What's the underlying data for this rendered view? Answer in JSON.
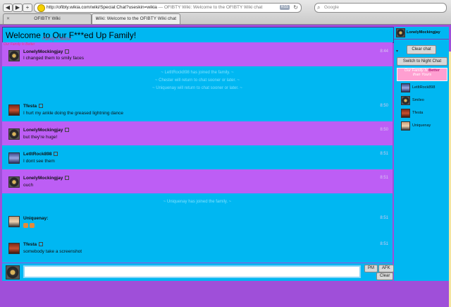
{
  "browser": {
    "url": "http://ofibty.wikia.com/wiki/Special:Chat?useskin=wikia",
    "window_title": "— OFIBTY Wiki: Welcome to the OFIBTY Wiki chat",
    "rss_label": "RSS",
    "search_placeholder": "Google",
    "tabs": [
      {
        "label": "OFIBTY Wiki"
      },
      {
        "label": "Wiki: Welcome to the OFIBTY Wiki chat"
      }
    ]
  },
  "chat": {
    "title": "Welcome to Our F***ed Up Family!",
    "watermark": "Family Is Better",
    "logo_text": "Our Family Is Better",
    "messages": [
      {
        "user": "LonelyMockingjay",
        "text": "I changed them to smily faces",
        "time": "8:44"
      },
      {
        "user": "Tfesta",
        "text": "I hurt my ankle doing the greased lightning dance",
        "time": "8:50"
      },
      {
        "user": "LonelyMockingjay",
        "text": "but they're huge!",
        "time": "8:50"
      },
      {
        "user": "LetItRock898",
        "text": "I dont see them",
        "time": "8:51"
      },
      {
        "user": "LonelyMockingjay",
        "text": "ouch",
        "time": "8:51"
      },
      {
        "user": "Uniquenay",
        "text": "",
        "time": "8:51"
      },
      {
        "user": "Tfesta",
        "text": "somebody take a screenshot",
        "time": "8:51"
      }
    ],
    "inline_alerts_a": [
      "~ LetItRock898 has joined the family. ~",
      "~ Chester will return to chat sooner or later. ~",
      "~ Uniquenay will return to chat sooner or later. ~"
    ],
    "inline_alert_b": "~ Uniquenay has joined the family. ~"
  },
  "bottom": {
    "pm_label": "PM",
    "afk_label": "AFK",
    "clear_label": "Clear"
  },
  "sidebar": {
    "me": "LonelyMockingjay",
    "clear_chat_label": "Clear chat",
    "night_chat_label": "Switch to Night Chat",
    "promo_top": "Our Family Is",
    "promo_mid": "Better",
    "promo_bot": "than Yours",
    "users": [
      {
        "name": "LetItRock898"
      },
      {
        "name": "Smileo"
      },
      {
        "name": "Tfesta"
      },
      {
        "name": "Uniquenay"
      }
    ]
  },
  "colors": {
    "panel": "#00b7f2",
    "purple_row": "#bd5ef5",
    "frame": "#9f4fd9"
  }
}
